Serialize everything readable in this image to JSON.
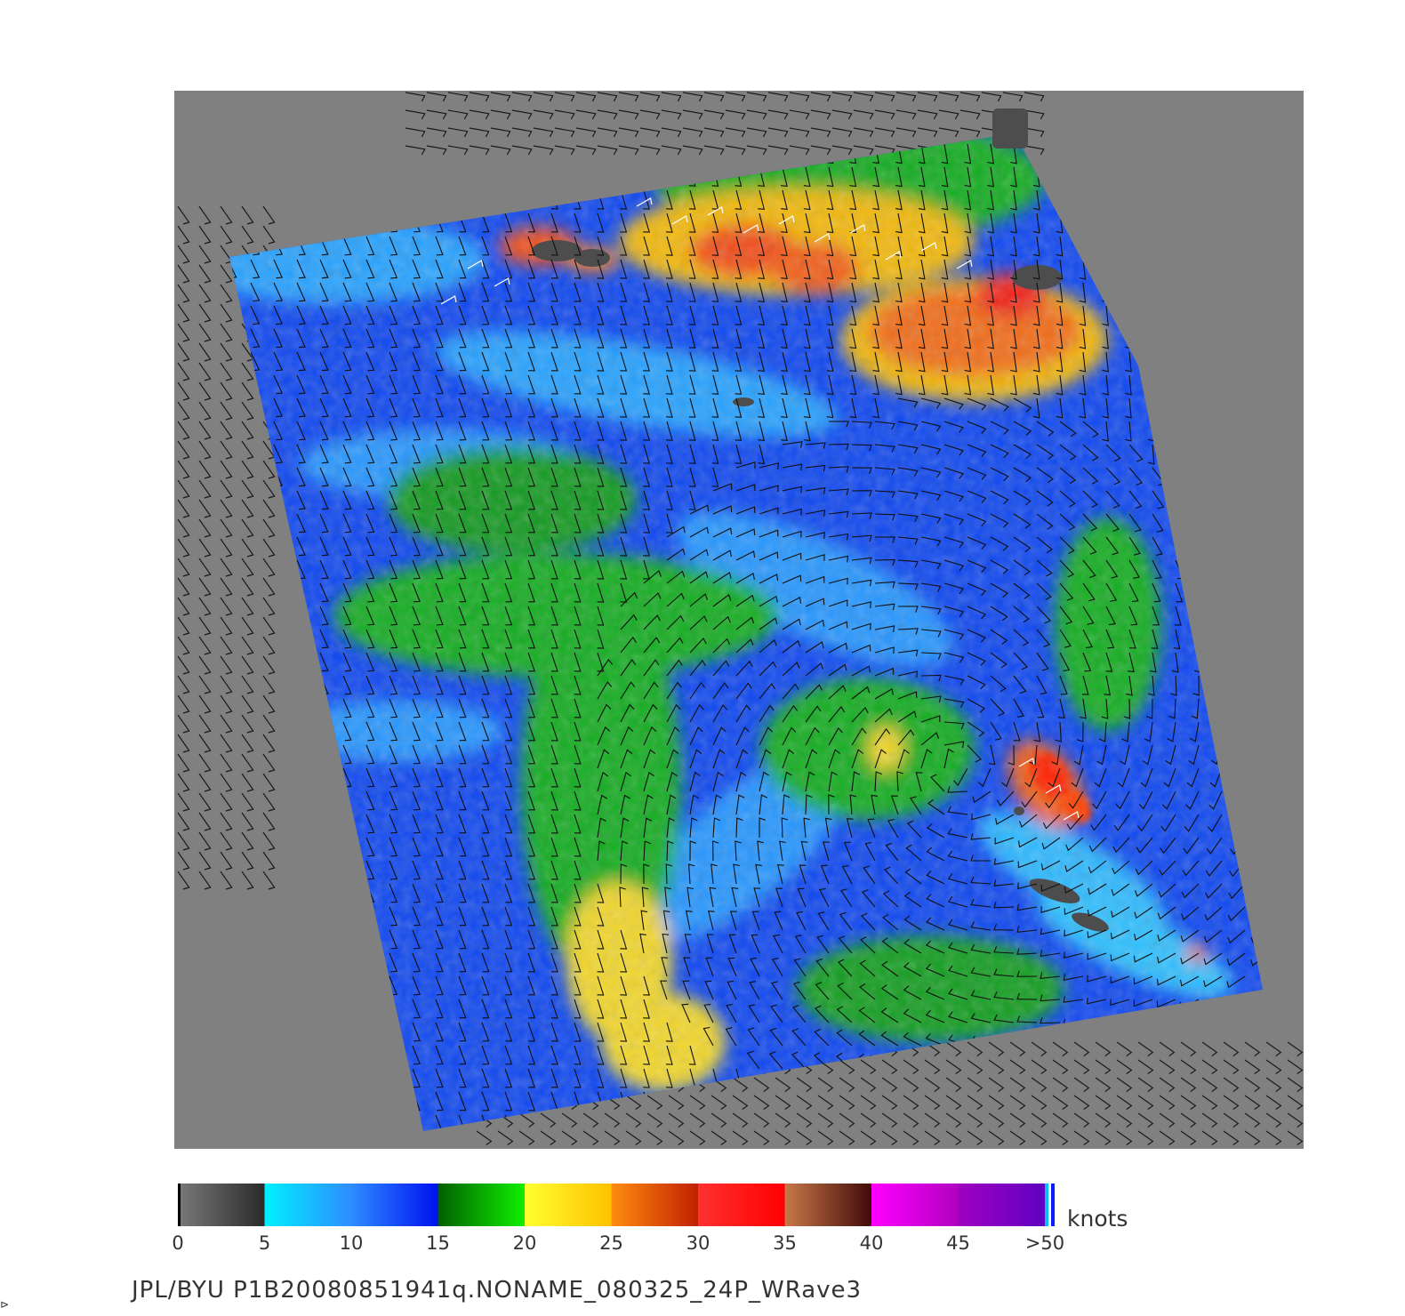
{
  "map": {
    "background_color": "#808080",
    "land_mask_color": "#4d4d4d",
    "wind_barb_color": "#1a1a1a",
    "flagged_barb_color": "#ffffff"
  },
  "colorbar": {
    "units": "knots",
    "ticks": [
      "0",
      "5",
      "10",
      "15",
      "20",
      "25",
      "30",
      "35",
      "40",
      "45",
      ">50"
    ],
    "segments": [
      {
        "from": 0,
        "to": 5,
        "start": "#7a7a7a",
        "end": "#2a2a2a"
      },
      {
        "from": 5,
        "to": 10,
        "start": "#00f0ff",
        "end": "#2e8cff"
      },
      {
        "from": 10,
        "to": 15,
        "start": "#2e8cff",
        "end": "#0010f0"
      },
      {
        "from": 15,
        "to": 20,
        "start": "#006000",
        "end": "#10f000"
      },
      {
        "from": 20,
        "to": 25,
        "start": "#ffff30",
        "end": "#ffc000"
      },
      {
        "from": 25,
        "to": 30,
        "start": "#ff8c10",
        "end": "#c02000"
      },
      {
        "from": 30,
        "to": 35,
        "start": "#ff3030",
        "end": "#ff0000"
      },
      {
        "from": 35,
        "to": 40,
        "start": "#c87848",
        "end": "#400a0a"
      },
      {
        "from": 40,
        "to": 45,
        "start": "#ff00ff",
        "end": "#b000c0"
      },
      {
        "from": 45,
        "to": 50,
        "start": "#a000c0",
        "end": "#6000c0"
      }
    ]
  },
  "caption": "JPL/BYU  P1B20080851941q.NONAME_080325_24P_WRave3",
  "corner_mark": "⊳"
}
